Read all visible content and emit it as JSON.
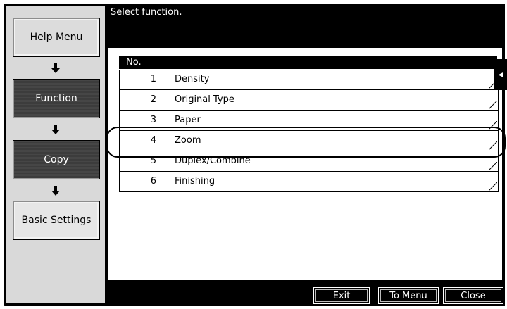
{
  "header": {
    "message": "Select function."
  },
  "sidebar": {
    "items": [
      {
        "label": "Help Menu"
      },
      {
        "label": "Function"
      },
      {
        "label": "Copy"
      },
      {
        "label": "Basic Settings"
      }
    ]
  },
  "table": {
    "header": "No.",
    "rows": [
      {
        "num": "1",
        "label": "Density"
      },
      {
        "num": "2",
        "label": "Original Type"
      },
      {
        "num": "3",
        "label": "Paper"
      },
      {
        "num": "4",
        "label": "Zoom"
      },
      {
        "num": "5",
        "label": "Duplex/Combine"
      },
      {
        "num": "6",
        "label": "Finishing"
      }
    ],
    "highlighted_row": "4"
  },
  "side_tab": {
    "icon": "left-arrow-icon",
    "label": "◂"
  },
  "footer": {
    "exit": "Exit",
    "to_menu": "To Menu",
    "close": "Close"
  }
}
